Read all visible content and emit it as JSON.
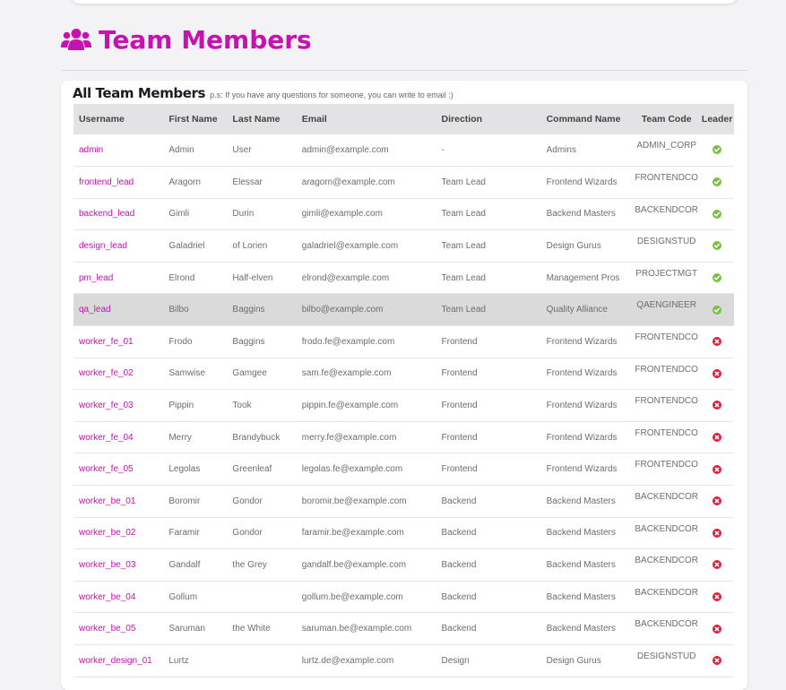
{
  "page": {
    "title": "Team Members"
  },
  "card": {
    "title": "All Team Members",
    "note": "p.s: If you have any questions for someone, you can write to email :)"
  },
  "colors": {
    "accent": "#c910b0",
    "leader_yes": "#7ac143",
    "leader_no": "#e01e3c",
    "selected_row": "#dadadb"
  },
  "table": {
    "headers": {
      "username": "Username",
      "first_name": "First Name",
      "last_name": "Last Name",
      "email": "Email",
      "direction": "Direction",
      "command_name": "Command Name",
      "team_code": "Team Code",
      "leader": "Leader"
    },
    "rows": [
      {
        "username": "admin",
        "first_name": "Admin",
        "last_name": "User",
        "email": "admin@example.com",
        "direction": "-",
        "command_name": "Admins",
        "team_code": "ADMIN_CORP",
        "leader": true,
        "leader_icon": "check-circle-icon"
      },
      {
        "username": "frontend_lead",
        "first_name": "Aragorn",
        "last_name": "Elessar",
        "email": "aragorn@example.com",
        "direction": "Team Lead",
        "command_name": "Frontend Wizards",
        "team_code": "FRONTENDCO",
        "leader": true,
        "leader_icon": "check-circle-icon"
      },
      {
        "username": "backend_lead",
        "first_name": "Gimli",
        "last_name": "Durin",
        "email": "gimli@example.com",
        "direction": "Team Lead",
        "command_name": "Backend Masters",
        "team_code": "BACKENDCOR",
        "leader": true,
        "leader_icon": "check-circle-icon"
      },
      {
        "username": "design_lead",
        "first_name": "Galadriel",
        "last_name": "of Lorien",
        "email": "galadriel@example.com",
        "direction": "Team Lead",
        "command_name": "Design Gurus",
        "team_code": "DESIGNSTUD",
        "leader": true,
        "leader_icon": "check-circle-icon"
      },
      {
        "username": "pm_lead",
        "first_name": "Elrond",
        "last_name": "Half-elven",
        "email": "elrond@example.com",
        "direction": "Team Lead",
        "command_name": "Management Pros",
        "team_code": "PROJECTMGT",
        "leader": true,
        "leader_icon": "check-circle-icon"
      },
      {
        "username": "qa_lead",
        "first_name": "Bilbo",
        "last_name": "Baggins",
        "email": "bilbo@example.com",
        "direction": "Team Lead",
        "command_name": "Quality Alliance",
        "team_code": "QAENGINEER",
        "leader": true,
        "leader_icon": "check-circle-icon",
        "selected": true
      },
      {
        "username": "worker_fe_01",
        "first_name": "Frodo",
        "last_name": "Baggins",
        "email": "frodo.fe@example.com",
        "direction": "Frontend",
        "command_name": "Frontend Wizards",
        "team_code": "FRONTENDCO",
        "leader": false,
        "leader_icon": "x-circle-icon"
      },
      {
        "username": "worker_fe_02",
        "first_name": "Samwise",
        "last_name": "Gamgee",
        "email": "sam.fe@example.com",
        "direction": "Frontend",
        "command_name": "Frontend Wizards",
        "team_code": "FRONTENDCO",
        "leader": false,
        "leader_icon": "x-circle-icon"
      },
      {
        "username": "worker_fe_03",
        "first_name": "Pippin",
        "last_name": "Took",
        "email": "pippin.fe@example.com",
        "direction": "Frontend",
        "command_name": "Frontend Wizards",
        "team_code": "FRONTENDCO",
        "leader": false,
        "leader_icon": "x-circle-icon"
      },
      {
        "username": "worker_fe_04",
        "first_name": "Merry",
        "last_name": "Brandybuck",
        "email": "merry.fe@example.com",
        "direction": "Frontend",
        "command_name": "Frontend Wizards",
        "team_code": "FRONTENDCO",
        "leader": false,
        "leader_icon": "x-circle-icon"
      },
      {
        "username": "worker_fe_05",
        "first_name": "Legolas",
        "last_name": "Greenleaf",
        "email": "legolas.fe@example.com",
        "direction": "Frontend",
        "command_name": "Frontend Wizards",
        "team_code": "FRONTENDCO",
        "leader": false,
        "leader_icon": "x-circle-icon"
      },
      {
        "username": "worker_be_01",
        "first_name": "Boromir",
        "last_name": "Gondor",
        "email": "boromir.be@example.com",
        "direction": "Backend",
        "command_name": "Backend Masters",
        "team_code": "BACKENDCOR",
        "leader": false,
        "leader_icon": "x-circle-icon"
      },
      {
        "username": "worker_be_02",
        "first_name": "Faramir",
        "last_name": "Gondor",
        "email": "faramir.be@example.com",
        "direction": "Backend",
        "command_name": "Backend Masters",
        "team_code": "BACKENDCOR",
        "leader": false,
        "leader_icon": "x-circle-icon"
      },
      {
        "username": "worker_be_03",
        "first_name": "Gandalf",
        "last_name": "the Grey",
        "email": "gandalf.be@example.com",
        "direction": "Backend",
        "command_name": "Backend Masters",
        "team_code": "BACKENDCOR",
        "leader": false,
        "leader_icon": "x-circle-icon"
      },
      {
        "username": "worker_be_04",
        "first_name": "Gollum",
        "last_name": "",
        "email": "gollum.be@example.com",
        "direction": "Backend",
        "command_name": "Backend Masters",
        "team_code": "BACKENDCOR",
        "leader": false,
        "leader_icon": "x-circle-icon"
      },
      {
        "username": "worker_be_05",
        "first_name": "Saruman",
        "last_name": "the White",
        "email": "saruman.be@example.com",
        "direction": "Backend",
        "command_name": "Backend Masters",
        "team_code": "BACKENDCOR",
        "leader": false,
        "leader_icon": "x-circle-icon"
      },
      {
        "username": "worker_design_01",
        "first_name": "Lurtz",
        "last_name": "",
        "email": "lurtz.de@example.com",
        "direction": "Design",
        "command_name": "Design Gurus",
        "team_code": "DESIGNSTUD",
        "leader": false,
        "leader_icon": "x-circle-icon"
      }
    ]
  }
}
